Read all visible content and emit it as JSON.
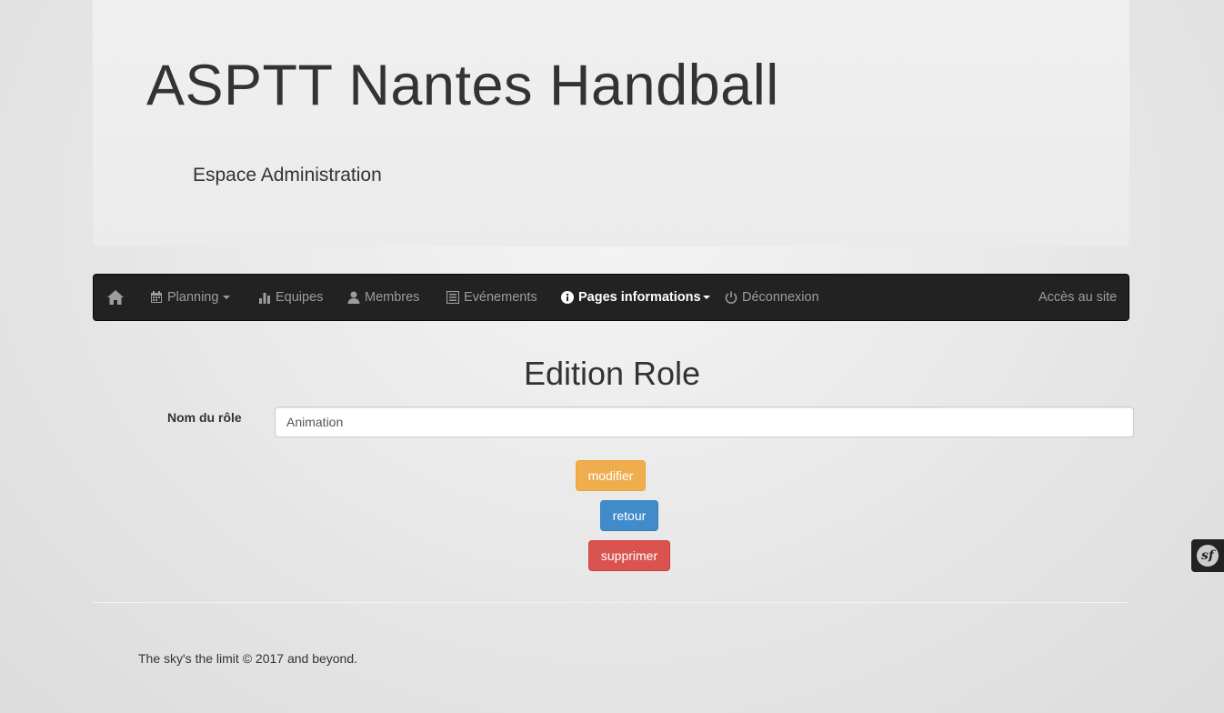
{
  "header": {
    "site_title": "ASPTT Nantes Handball",
    "subtitle": "Espace Administration"
  },
  "navbar": {
    "home_icon": "home-icon",
    "items": [
      {
        "label": "Planning",
        "icon": "calendar-icon",
        "dropdown": true
      },
      {
        "label": "Equipes",
        "icon": "stats-icon",
        "dropdown": false
      },
      {
        "label": "Membres",
        "icon": "user-icon",
        "dropdown": false
      },
      {
        "label": "Evénements",
        "icon": "list-icon",
        "dropdown": false
      },
      {
        "label": "Pages informations",
        "icon": "info-icon",
        "dropdown": true,
        "active": true
      },
      {
        "label": "Déconnexion",
        "icon": "power-icon",
        "dropdown": false
      }
    ],
    "right_link": "Accès au site"
  },
  "main": {
    "heading": "Edition Role",
    "form": {
      "role_name_label": "Nom du rôle",
      "role_name_value": "Animation"
    },
    "buttons": {
      "modify": "modifier",
      "back": "retour",
      "delete": "supprimer"
    }
  },
  "footer": {
    "text": "The sky's the limit © 2017 and beyond."
  },
  "debug_toolbar": {
    "logo_text": "sf"
  },
  "colors": {
    "navbar_bg": "#222222",
    "warning": "#f0ad4e",
    "primary": "#428bca",
    "danger": "#d9534f"
  }
}
